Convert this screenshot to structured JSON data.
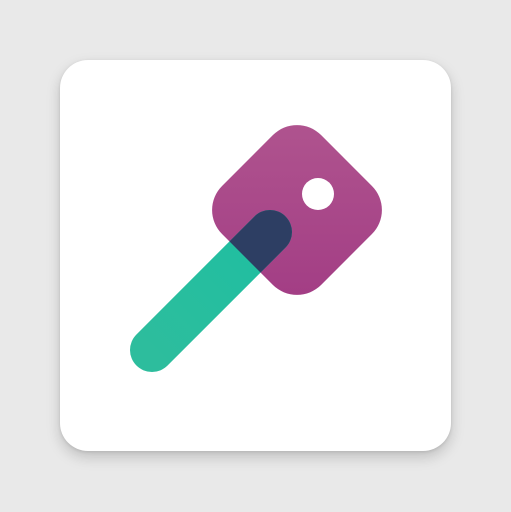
{
  "icon": {
    "name": "key-icon",
    "colors": {
      "page_background": "#e9e9e9",
      "tile_background": "#ffffff",
      "key_head": "#a63f86",
      "key_head_light": "#b0558f",
      "key_shaft": "#25bf9f",
      "key_overlap": "#2d3e63",
      "key_hole": "#ffffff"
    }
  }
}
